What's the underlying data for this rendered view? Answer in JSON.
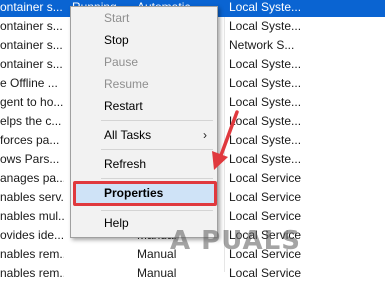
{
  "services": {
    "rows": [
      {
        "description": "ontainer s...",
        "status": "Running",
        "startup": "Automatic",
        "logon": "Local Syste..."
      },
      {
        "description": "ontainer s...",
        "status": "",
        "startup": "",
        "logon": "Local Syste..."
      },
      {
        "description": "ontainer s...",
        "status": "",
        "startup": "",
        "logon": "Network S..."
      },
      {
        "description": "ontainer s...",
        "status": "",
        "startup": "",
        "logon": "Local Syste..."
      },
      {
        "description": "e Offline ...",
        "status": "",
        "startup": "",
        "logon": "Local Syste..."
      },
      {
        "description": "gent to ho...",
        "status": "",
        "startup": "",
        "logon": "Local Syste..."
      },
      {
        "description": "elps the c...",
        "status": "",
        "startup": "",
        "logon": "Local Syste..."
      },
      {
        "description": "forces pa...",
        "status": "",
        "startup": "",
        "logon": "Local Syste..."
      },
      {
        "description": "ows Pars...",
        "status": "",
        "startup": "",
        "logon": "Local Syste..."
      },
      {
        "description": "anages pa...",
        "status": "",
        "startup": "",
        "logon": "Local Service"
      },
      {
        "description": "nables serv...",
        "status": "",
        "startup": "",
        "logon": "Local Service"
      },
      {
        "description": "nables mul...",
        "status": "",
        "startup": "",
        "logon": "Local Service"
      },
      {
        "description": "ovides ide...",
        "status": "",
        "startup": "Manual",
        "logon": "Local Service"
      },
      {
        "description": "nables rem...",
        "status": "",
        "startup": "Manual",
        "logon": "Local Service"
      },
      {
        "description": "nables rem...",
        "status": "",
        "startup": "Manual",
        "logon": "Local Service"
      }
    ]
  },
  "context_menu": {
    "start": "Start",
    "stop": "Stop",
    "pause": "Pause",
    "resume": "Resume",
    "restart": "Restart",
    "all_tasks": "All Tasks",
    "submenu_arrow": "›",
    "refresh": "Refresh",
    "properties": "Properties",
    "help": "Help"
  },
  "watermark": {
    "text": "A  PUALS"
  },
  "colors": {
    "selection": "#0a64d2",
    "highlight_border": "#e0393e",
    "arrow": "#e0393e"
  },
  "icons": {
    "annotation_arrow": "red-arrow-icon"
  }
}
